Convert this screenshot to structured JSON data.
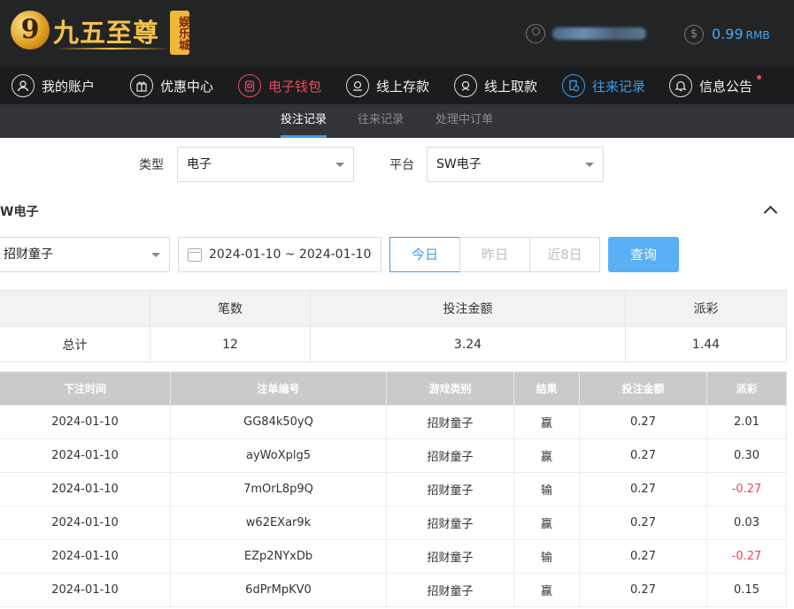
{
  "header": {
    "logo_glyph": "9",
    "logo_text": "九五至尊",
    "logo_tag": "娱乐城",
    "balance_value": "0.99",
    "balance_unit": "RMB"
  },
  "nav": [
    {
      "label": "我的账户",
      "icon": "user-icon"
    },
    {
      "label": "优惠中心",
      "icon": "gift-icon"
    },
    {
      "label": "电子钱包",
      "icon": "wallet-icon"
    },
    {
      "label": "线上存款",
      "icon": "deposit-icon"
    },
    {
      "label": "线上取款",
      "icon": "withdraw-icon"
    },
    {
      "label": "往来记录",
      "icon": "records-icon"
    },
    {
      "label": "信息公告",
      "icon": "bell-icon"
    }
  ],
  "subtabs": [
    "投注记录",
    "往来记录",
    "处理中订单"
  ],
  "filters": {
    "type_label": "类型",
    "type_value": "电子",
    "platform_label": "平台",
    "platform_value": "SW电子"
  },
  "section": {
    "title": "W电子",
    "game_select": "招财童子",
    "date_range": "2024-01-10 ~ 2024-01-10",
    "quick_today": "今日",
    "quick_yesterday": "昨日",
    "quick_8days": "近8日",
    "query_label": "查询"
  },
  "summary": {
    "headers": [
      "",
      "笔数",
      "投注金额",
      "派彩"
    ],
    "row": [
      "总计",
      "12",
      "3.24",
      "1.44"
    ]
  },
  "detail": {
    "headers": [
      "下注时间",
      "注单编号",
      "游戏类别",
      "结果",
      "投注金额",
      "派彩"
    ],
    "rows": [
      [
        "2024-01-10",
        "GG84k50yQ",
        "招财童子",
        "赢",
        "0.27",
        "2.01"
      ],
      [
        "2024-01-10",
        "ayWoXplg5",
        "招财童子",
        "赢",
        "0.27",
        "0.30"
      ],
      [
        "2024-01-10",
        "7mOrL8p9Q",
        "招财童子",
        "输",
        "0.27",
        "-0.27"
      ],
      [
        "2024-01-10",
        "w62EXar9k",
        "招财童子",
        "赢",
        "0.27",
        "0.03"
      ],
      [
        "2024-01-10",
        "EZp2NYxDb",
        "招财童子",
        "输",
        "0.27",
        "-0.27"
      ],
      [
        "2024-01-10",
        "6dPrMpKV0",
        "招财童子",
        "赢",
        "0.27",
        "0.15"
      ]
    ]
  },
  "colors": {
    "accent_blue": "#3d9ee8",
    "accent_red": "#e84a5a",
    "header_bg": "#222426"
  }
}
